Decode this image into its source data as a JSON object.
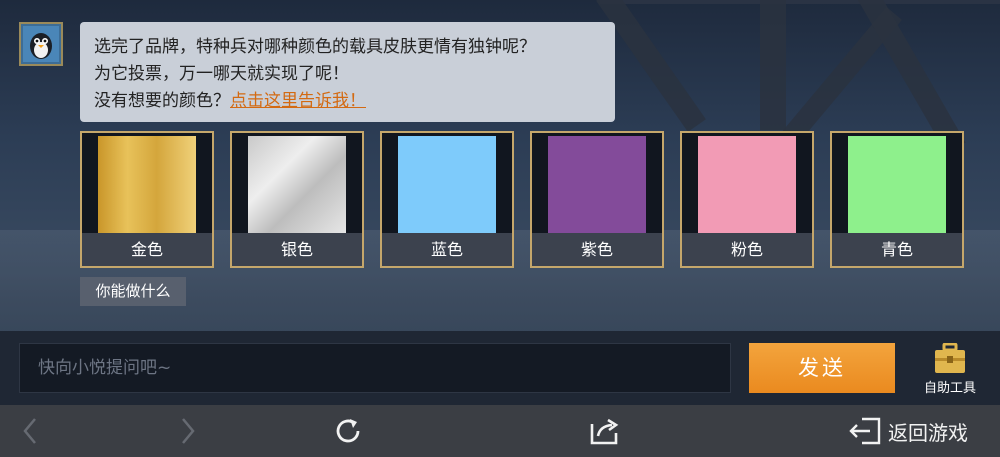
{
  "bubble": {
    "line1": "选完了品牌，特种兵对哪种颜色的载具皮肤更情有独钟呢？",
    "line2": "为它投票，万一哪天就实现了呢！",
    "line3_prefix": "没有想要的颜色？",
    "line3_link": "点击这里告诉我！"
  },
  "swatches": [
    {
      "label": "金色",
      "color": "#d8ad45"
    },
    {
      "label": "银色",
      "color": "#dcdcdc"
    },
    {
      "label": "蓝色",
      "color": "#7ecbfb"
    },
    {
      "label": "紫色",
      "color": "#834b9a"
    },
    {
      "label": "粉色",
      "color": "#f29bb5"
    },
    {
      "label": "青色",
      "color": "#8ef08c"
    }
  ],
  "chip": {
    "label": "你能做什么"
  },
  "input": {
    "placeholder": "快向小悦提问吧~"
  },
  "send": {
    "label": "发送"
  },
  "tool": {
    "label": "自助工具"
  },
  "nav": {
    "back_game": "返回游戏"
  },
  "icons": {
    "back": "chevron-left-icon",
    "forward": "chevron-right-icon",
    "refresh": "refresh-icon",
    "share": "share-icon",
    "exit": "exit-arrow-icon",
    "toolbox": "toolbox-icon",
    "avatar": "penguin-avatar-icon"
  }
}
